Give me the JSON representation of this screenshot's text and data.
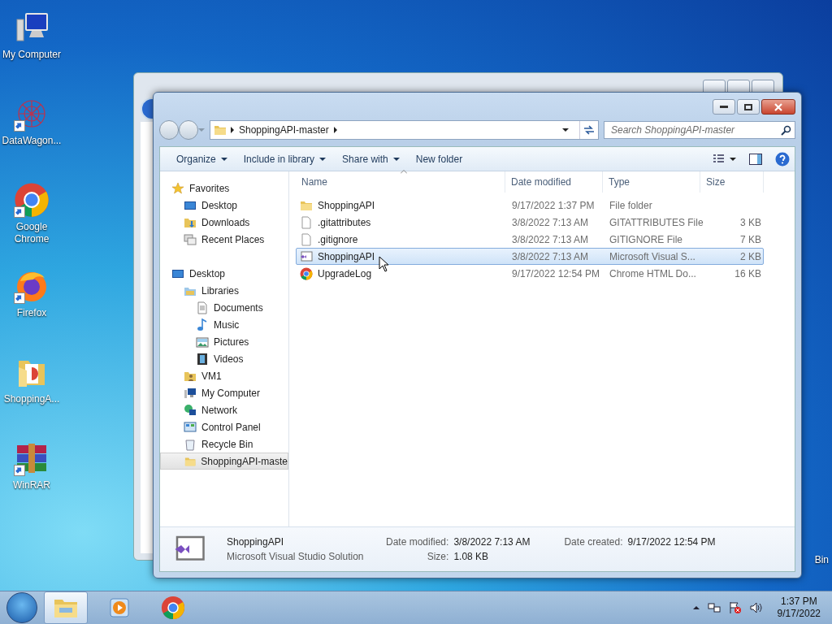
{
  "desktop_icons": [
    {
      "label": "My Computer",
      "kind": "computer",
      "shortcut": false
    },
    {
      "label": "DataWagon...",
      "kind": "network-art",
      "shortcut": true
    },
    {
      "label": "Google Chrome",
      "kind": "chrome",
      "shortcut": true
    },
    {
      "label": "Firefox",
      "kind": "firefox",
      "shortcut": true
    },
    {
      "label": "ShoppingA...",
      "kind": "folder",
      "shortcut": false
    },
    {
      "label": "WinRAR",
      "kind": "winrar",
      "shortcut": true
    }
  ],
  "partial_desktop_icon": {
    "label": "Bin"
  },
  "explorer": {
    "breadcrumb": [
      "ShoppingAPI-master"
    ],
    "search": {
      "placeholder": "Search ShoppingAPI-master"
    },
    "toolbar": [
      {
        "label": "Organize",
        "dropdown": true
      },
      {
        "label": "Include in library",
        "dropdown": true
      },
      {
        "label": "Share with",
        "dropdown": true
      },
      {
        "label": "New folder",
        "dropdown": false
      }
    ],
    "nav": [
      {
        "label": "Favorites",
        "kind": "star",
        "selected": false,
        "children": [
          {
            "label": "Desktop",
            "kind": "desktop",
            "selected": false
          },
          {
            "label": "Downloads",
            "kind": "downloads",
            "selected": false
          },
          {
            "label": "Recent Places",
            "kind": "recent",
            "selected": false
          }
        ]
      },
      {
        "label": "Desktop",
        "kind": "desktop",
        "selected": false,
        "children": [
          {
            "label": "Libraries",
            "kind": "libraries",
            "selected": false,
            "children": [
              {
                "label": "Documents",
                "kind": "document",
                "selected": false
              },
              {
                "label": "Music",
                "kind": "music",
                "selected": false
              },
              {
                "label": "Pictures",
                "kind": "pictures",
                "selected": false
              },
              {
                "label": "Videos",
                "kind": "videos",
                "selected": false
              }
            ]
          },
          {
            "label": "VM1",
            "kind": "user-folder",
            "selected": false
          },
          {
            "label": "My Computer",
            "kind": "computer",
            "selected": false
          },
          {
            "label": "Network",
            "kind": "network",
            "selected": false
          },
          {
            "label": "Control Panel",
            "kind": "control-panel",
            "selected": false
          },
          {
            "label": "Recycle Bin",
            "kind": "recycle",
            "selected": false
          },
          {
            "label": "ShoppingAPI-maste",
            "kind": "folder",
            "selected": true
          }
        ]
      }
    ],
    "columns": [
      {
        "label": "Name",
        "sorted": true
      },
      {
        "label": "Date modified",
        "sorted": false
      },
      {
        "label": "Type",
        "sorted": false
      },
      {
        "label": "Size",
        "sorted": false
      }
    ],
    "rows": [
      {
        "name": "ShoppingAPI",
        "kind": "folder",
        "date": "9/17/2022 1:37 PM",
        "type": "File folder",
        "size": "",
        "selected": false
      },
      {
        "name": ".gitattributes",
        "kind": "file",
        "date": "3/8/2022 7:13 AM",
        "type": "GITATTRIBUTES File",
        "size": "3 KB",
        "selected": false
      },
      {
        "name": ".gitignore",
        "kind": "file",
        "date": "3/8/2022 7:13 AM",
        "type": "GITIGNORE File",
        "size": "7 KB",
        "selected": false
      },
      {
        "name": "ShoppingAPI",
        "kind": "solution",
        "date": "3/8/2022 7:13 AM",
        "type": "Microsoft Visual S...",
        "size": "2 KB",
        "selected": true
      },
      {
        "name": "UpgradeLog",
        "kind": "chrome",
        "date": "9/17/2022 12:54 PM",
        "type": "Chrome HTML Do...",
        "size": "16 KB",
        "selected": false
      }
    ],
    "details": {
      "name": "ShoppingAPI",
      "type": "Microsoft Visual Studio Solution",
      "fields": [
        {
          "label": "Date modified:",
          "value": "3/8/2022 7:13 AM"
        },
        {
          "label": "Size:",
          "value": "1.08 KB"
        },
        {
          "label": "Date created:",
          "value": "9/17/2022 12:54 PM"
        }
      ]
    }
  },
  "taskbar": {
    "items": [
      {
        "kind": "explorer",
        "selected": true
      },
      {
        "kind": "media",
        "selected": false
      },
      {
        "kind": "chrome",
        "selected": false
      }
    ],
    "clock": {
      "time": "1:37 PM",
      "date": "9/17/2022"
    }
  }
}
